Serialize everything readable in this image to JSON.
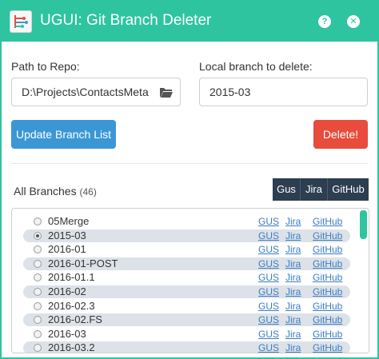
{
  "window": {
    "title": "UGUI: Git Branch Deleter",
    "help_glyph": "?",
    "close_glyph": "✕",
    "accent": "#2ec4a0"
  },
  "form": {
    "path_label": "Path to Repo:",
    "path_value": "D:\\Projects\\ContactsMeta",
    "local_label": "Local branch to delete:",
    "local_value": "2015-03"
  },
  "buttons": {
    "update": "Update Branch List",
    "delete": "Delete!"
  },
  "branches": {
    "title": "All Branches",
    "count": "(46)",
    "link_buttons": [
      "Gus",
      "Jira",
      "GitHub"
    ],
    "rows": [
      {
        "name": "05Merge",
        "selected": false
      },
      {
        "name": "2015-03",
        "selected": true
      },
      {
        "name": "2016-01",
        "selected": false
      },
      {
        "name": "2016-01-POST",
        "selected": false
      },
      {
        "name": "2016-01.1",
        "selected": false
      },
      {
        "name": "2016-02",
        "selected": false
      },
      {
        "name": "2016-02.3",
        "selected": false
      },
      {
        "name": "2016-02.FS",
        "selected": false
      },
      {
        "name": "2016-03",
        "selected": false
      },
      {
        "name": "2016-03.2",
        "selected": false
      }
    ],
    "row_links": [
      "GUS",
      "Jira",
      "GitHub"
    ]
  }
}
